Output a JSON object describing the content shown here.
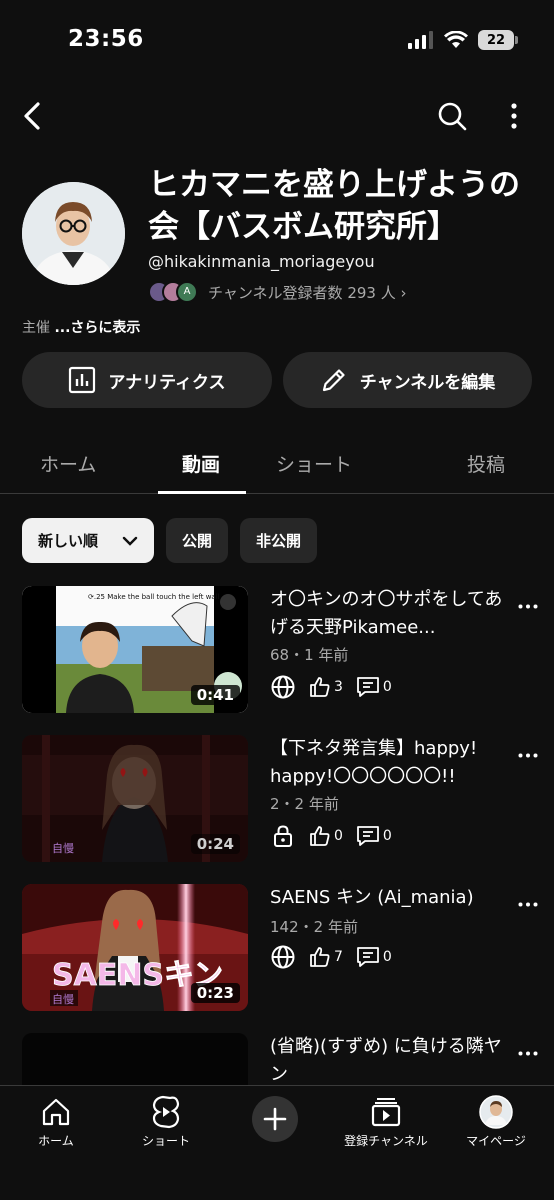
{
  "status_bar": {
    "time": "23:56",
    "battery": "22"
  },
  "channel": {
    "title": "ヒカマニを盛り上げようの会【バスボム研究所】",
    "handle": "@hikakinmania_moriageyou",
    "subscribers": "チャンネル登録者数 293 人 ›",
    "description_prefix": "主催",
    "description_more": "...さらに表示"
  },
  "actions": {
    "analytics": "アナリティクス",
    "edit_channel": "チャンネルを編集"
  },
  "tabs": [
    "ホーム",
    "動画",
    "ショート",
    "投稿"
  ],
  "chips": {
    "sort": "新しい順",
    "public": "公開",
    "private": "非公開"
  },
  "videos": [
    {
      "title": "オ〇キンのオ〇サポをしてあげる天野Pikamee...",
      "meta": "68・1 年前",
      "likes": "3",
      "comments": "0",
      "duration": "0:41",
      "visibility": "globe-icon",
      "thumb_text": "Make the ball touch the left wall"
    },
    {
      "title": "【下ネタ発言集】happy! happy!〇〇〇〇〇〇!!",
      "meta": "2・2 年前",
      "likes": "0",
      "comments": "0",
      "duration": "0:24",
      "visibility": "lock-icon",
      "thumb_tag": "自慢"
    },
    {
      "title": "SAENS キン (Ai_mania)",
      "meta": "142・2 年前",
      "likes": "7",
      "comments": "0",
      "duration": "0:23",
      "visibility": "globe-icon",
      "thumb_text": "SAENSキン",
      "thumb_tag": "自慢"
    },
    {
      "title": "(省略)(すずめ) に負ける隣ヤン"
    }
  ],
  "bottom_nav": {
    "home": "ホーム",
    "shorts": "ショート",
    "subscriptions": "登録チャンネル",
    "mypage": "マイページ"
  }
}
